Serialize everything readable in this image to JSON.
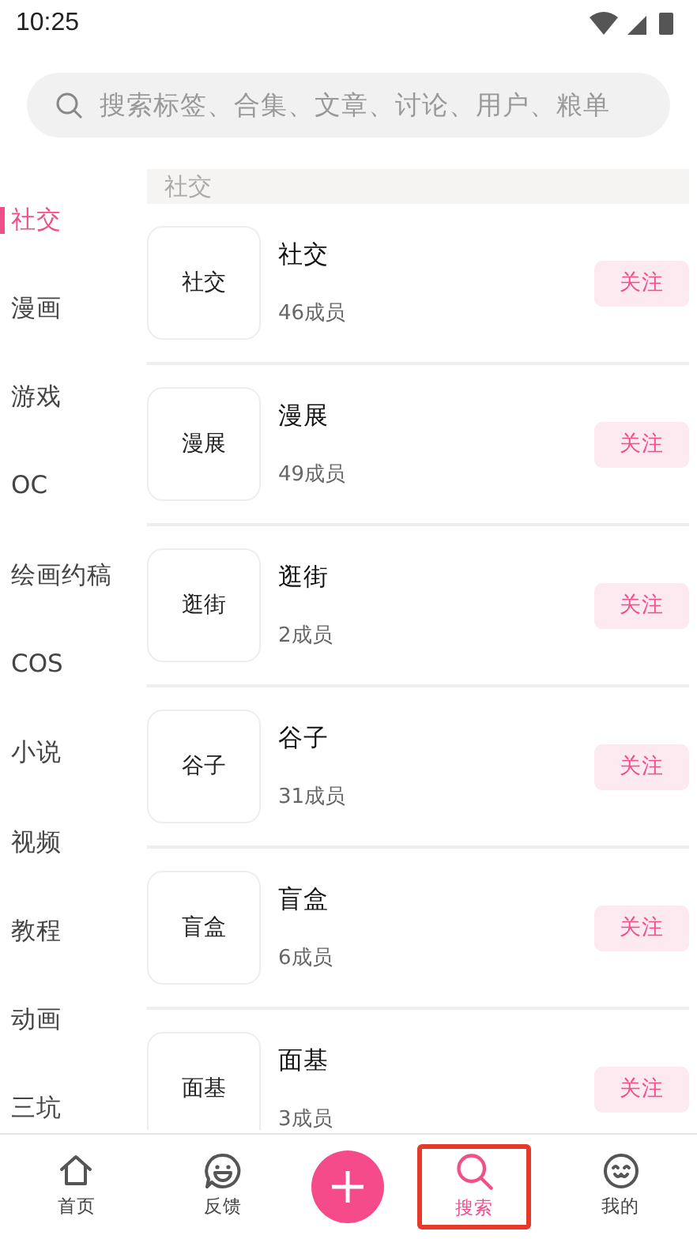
{
  "status_bar": {
    "time": "10:25"
  },
  "search": {
    "placeholder": "搜索标签、合集、文章、讨论、用户、粮单"
  },
  "categories": [
    {
      "label": "社交",
      "selected": true
    },
    {
      "label": "漫画",
      "selected": false
    },
    {
      "label": "游戏",
      "selected": false
    },
    {
      "label": "OC",
      "selected": false
    },
    {
      "label": "绘画约稿",
      "selected": false
    },
    {
      "label": "COS",
      "selected": false
    },
    {
      "label": "小说",
      "selected": false
    },
    {
      "label": "视频",
      "selected": false
    },
    {
      "label": "教程",
      "selected": false
    },
    {
      "label": "动画",
      "selected": false
    },
    {
      "label": "三坑",
      "selected": false
    }
  ],
  "section_header": "社交",
  "groups": [
    {
      "thumb_text": "社交",
      "name": "社交",
      "members": "46成员",
      "follow": "关注"
    },
    {
      "thumb_text": "漫展",
      "name": "漫展",
      "members": "49成员",
      "follow": "关注"
    },
    {
      "thumb_text": "逛街",
      "name": "逛街",
      "members": "2成员",
      "follow": "关注"
    },
    {
      "thumb_text": "谷子",
      "name": "谷子",
      "members": "31成员",
      "follow": "关注"
    },
    {
      "thumb_text": "盲盒",
      "name": "盲盒",
      "members": "6成员",
      "follow": "关注"
    },
    {
      "thumb_text": "面基",
      "name": "面基",
      "members": "3成员",
      "follow": "关注"
    }
  ],
  "bottom_nav": [
    {
      "kind": "home",
      "label": "首页",
      "selected": false
    },
    {
      "kind": "feedback",
      "label": "反馈",
      "selected": false
    },
    {
      "kind": "add"
    },
    {
      "kind": "search",
      "label": "搜索",
      "selected": true
    },
    {
      "kind": "me",
      "label": "我的",
      "selected": false
    }
  ]
}
